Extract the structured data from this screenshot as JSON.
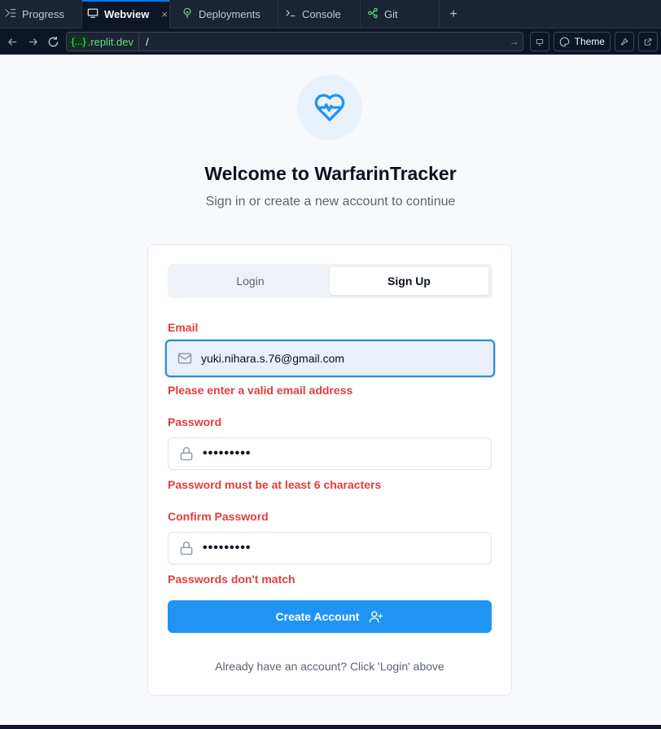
{
  "tabs": [
    {
      "label": "Progress",
      "icon": "progress-icon"
    },
    {
      "label": "Webview",
      "icon": "webview-icon",
      "active": true
    },
    {
      "label": "Deployments",
      "icon": "deployments-icon"
    },
    {
      "label": "Console",
      "icon": "console-icon"
    },
    {
      "label": "Git",
      "icon": "git-icon"
    }
  ],
  "tab_close": "×",
  "tab_add": "+",
  "url": {
    "badge": "{...}",
    "host": ".replit.dev",
    "path": "/",
    "go": "→"
  },
  "chrome": {
    "theme_label": "Theme"
  },
  "page": {
    "title": "Welcome to WarfarinTracker",
    "subtitle": "Sign in or create a new account to continue",
    "tabs": {
      "login": "Login",
      "signup": "Sign Up"
    },
    "email": {
      "label": "Email",
      "value": "yuki.nihara.s.76@gmail.com",
      "error": "Please enter a valid email address"
    },
    "password": {
      "label": "Password",
      "value": "•••••••••",
      "error": "Password must be at least 6 characters"
    },
    "confirm": {
      "label": "Confirm Password",
      "value": "•••••••••",
      "error": "Passwords don't match"
    },
    "submit_label": "Create Account",
    "footer": "Already have an account? Click 'Login' above"
  },
  "colors": {
    "accent": "#2094f3",
    "error": "#e23d3d",
    "focus_border": "#2a8fd8"
  }
}
